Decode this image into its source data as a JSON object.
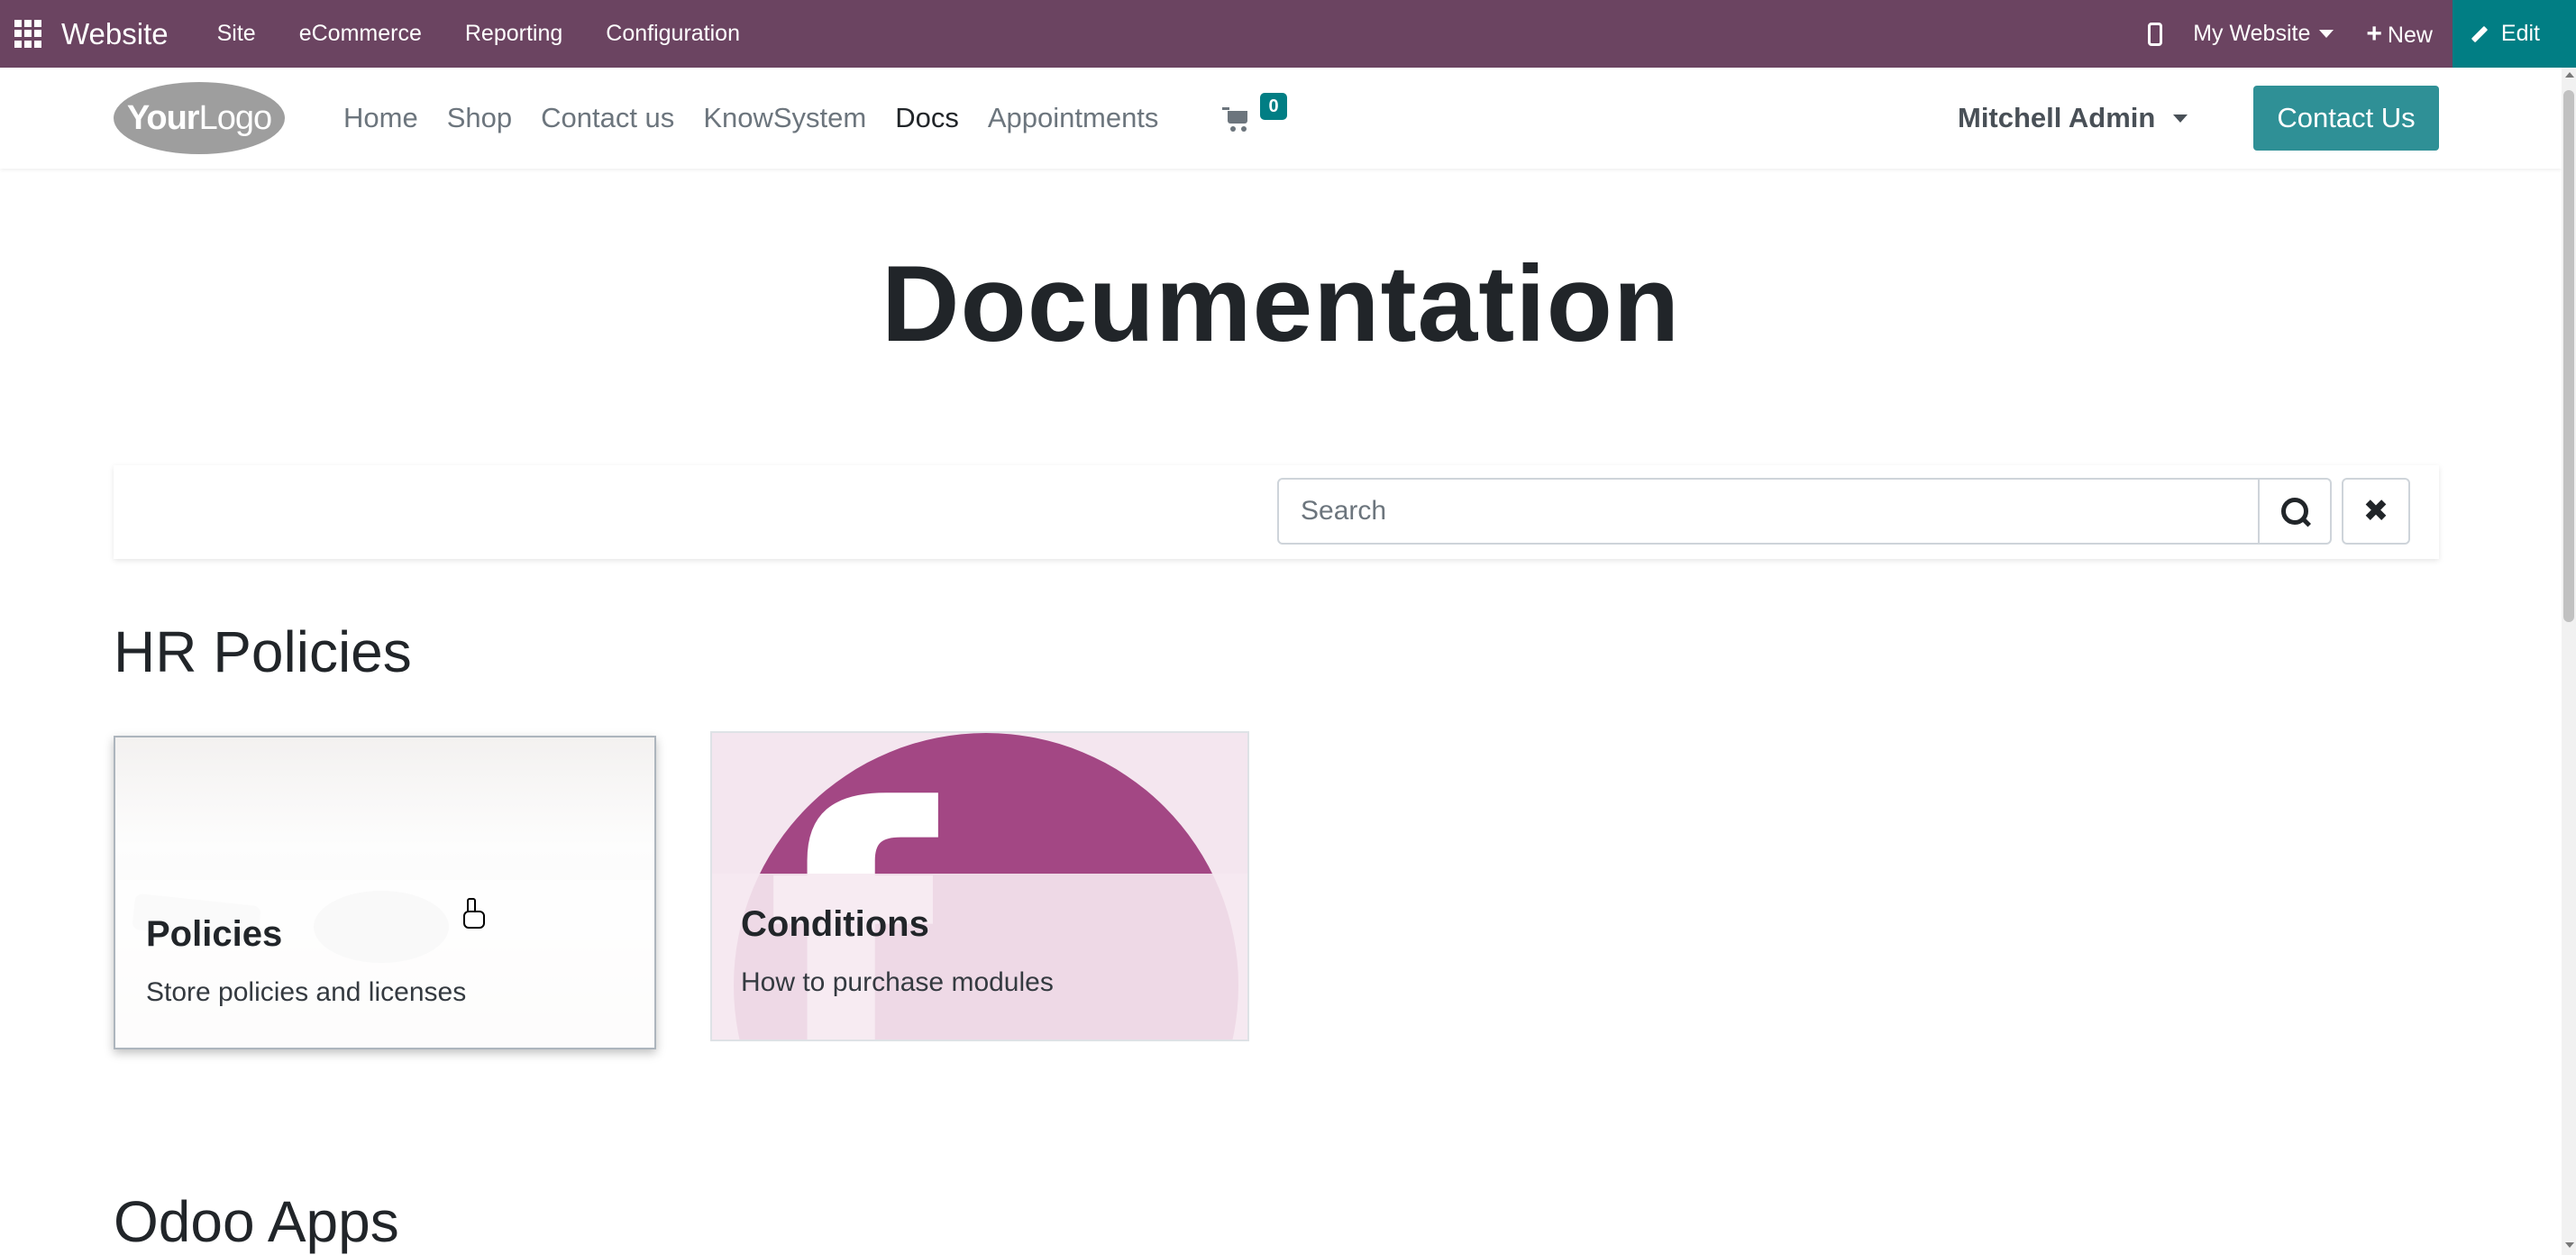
{
  "admin_bar": {
    "app_name": "Website",
    "menus": [
      "Site",
      "eCommerce",
      "Reporting",
      "Configuration"
    ],
    "website_selector": "My Website",
    "new_label": "New",
    "edit_label": "Edit",
    "background_color": "#6b4461",
    "edit_color": "#017e84"
  },
  "header": {
    "logo_text_bold": "Your",
    "logo_text": "Logo",
    "nav": [
      "Home",
      "Shop",
      "Contact us",
      "KnowSystem",
      "Docs",
      "Appointments"
    ],
    "active_nav": "Docs",
    "cart_count": "0",
    "user_name": "Mitchell Admin",
    "contact_button": "Contact Us",
    "accent_color": "#2f9096"
  },
  "main": {
    "title": "Documentation",
    "search": {
      "placeholder": "Search",
      "value": ""
    },
    "sections": [
      {
        "heading": "HR Policies",
        "cards": [
          {
            "title": "Policies",
            "description": "Store policies and licenses"
          },
          {
            "title": "Conditions",
            "description": "How to purchase modules",
            "image_color": "#a34784"
          }
        ]
      },
      {
        "heading": "Odoo Apps",
        "cards": []
      }
    ]
  }
}
